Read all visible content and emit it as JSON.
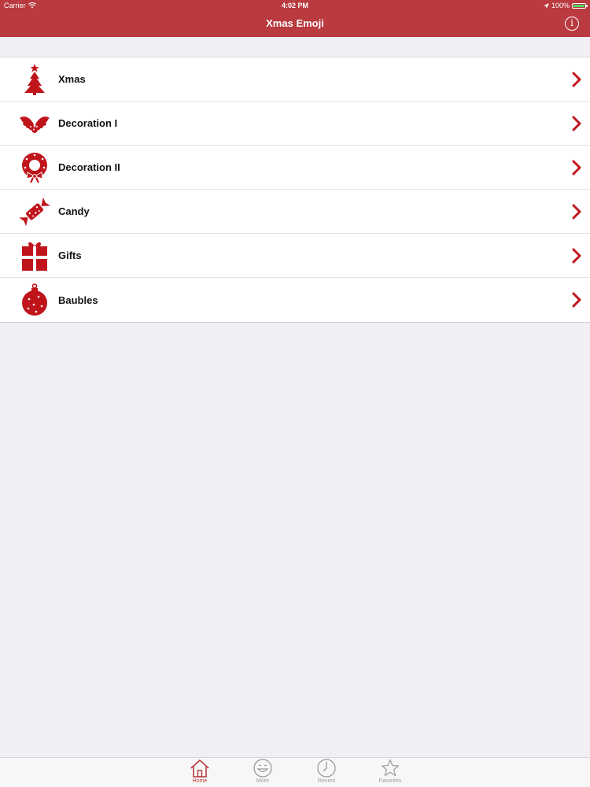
{
  "status_bar": {
    "carrier": "Carrier",
    "time": "4:02 PM",
    "battery": "100%"
  },
  "nav": {
    "title": "Xmas Emoji"
  },
  "colors": {
    "accent": "#b93a3f",
    "icon_red": "#c0141b",
    "background": "#efeff4"
  },
  "categories": [
    {
      "label": "Xmas",
      "icon": "christmas-tree-icon"
    },
    {
      "label": "Decoration I",
      "icon": "holly-icon"
    },
    {
      "label": "Decoration II",
      "icon": "wreath-icon"
    },
    {
      "label": "Candy",
      "icon": "candy-icon"
    },
    {
      "label": "Gifts",
      "icon": "gift-icon"
    },
    {
      "label": "Baubles",
      "icon": "bauble-icon"
    }
  ],
  "tabs": [
    {
      "label": "Home",
      "icon": "home-icon",
      "active": true
    },
    {
      "label": "More",
      "icon": "smiley-icon",
      "active": false
    },
    {
      "label": "Recent",
      "icon": "clock-icon",
      "active": false
    },
    {
      "label": "Favorites",
      "icon": "star-icon",
      "active": false
    }
  ]
}
